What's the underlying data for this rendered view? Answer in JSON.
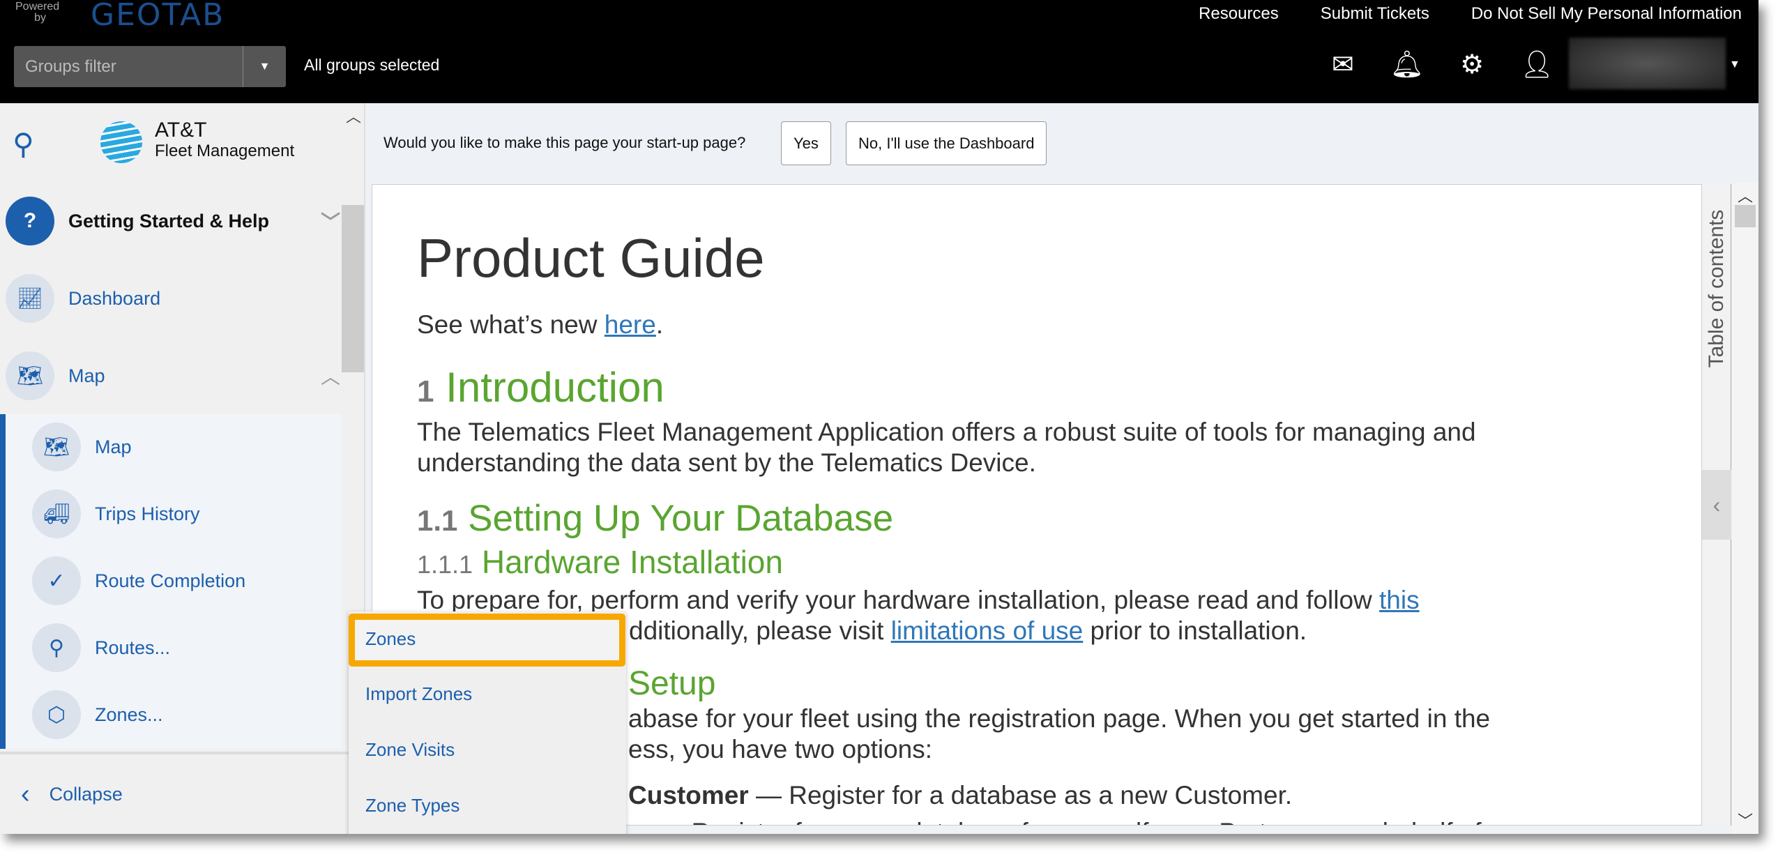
{
  "header": {
    "powered_by": "Powered by",
    "brand": "GEOTAB",
    "links": [
      "Resources",
      "Submit Tickets",
      "Do Not Sell My Personal Information"
    ],
    "groups_filter_placeholder": "Groups filter",
    "groups_status": "All groups selected"
  },
  "sidebar": {
    "logo_line1": "AT&T",
    "logo_line2": "Fleet Management",
    "items": [
      {
        "label": "Getting Started & Help"
      },
      {
        "label": "Dashboard"
      },
      {
        "label": "Map"
      }
    ],
    "sub_items": [
      {
        "label": "Map"
      },
      {
        "label": "Trips History"
      },
      {
        "label": "Route Completion"
      },
      {
        "label": "Routes..."
      },
      {
        "label": "Zones..."
      }
    ],
    "collapse": "Collapse"
  },
  "startup_prompt": {
    "question": "Would you like to make this page your start-up page?",
    "yes": "Yes",
    "no": "No, I'll use the Dashboard"
  },
  "document": {
    "title": "Product Guide",
    "whats_new": "See what’s new ",
    "here": "here",
    "intro_num": "1",
    "intro": "Introduction",
    "intro_p1": "The Telematics Fleet Management Application offers a robust suite of tools for managing and",
    "intro_p2": "understanding the data sent by the Telematics Device.",
    "s11_num": "1.1",
    "s11": "Setting Up Your Database",
    "s111_num": "1.1.1",
    "s111": "Hardware Installation",
    "hw_p1": "To prepare for, perform and verify your hardware installation, please read and follow ",
    "hw_this": "this",
    "hw_p2a": "dditionally, please visit ",
    "hw_limits": "limitations of use",
    "hw_p2b": " prior to installation.",
    "setup_frag": "Setup",
    "db_p1": "abase for your fleet using the registration page. When you get started in the",
    "db_p2": "ess, you have two options:",
    "cust_bold": "Customer",
    "cust_text": " — Register for a database as a new Customer.",
    "last_frag": "er — Register for a new database for yourself, as a Partner, or on behalf of a"
  },
  "toc_label": "Table of contents",
  "popup_menu": {
    "items": [
      "Zones",
      "Import Zones",
      "Zone Visits",
      "Zone Types"
    ],
    "highlighted": "Zones",
    "highlight_color": "#f7a800"
  }
}
